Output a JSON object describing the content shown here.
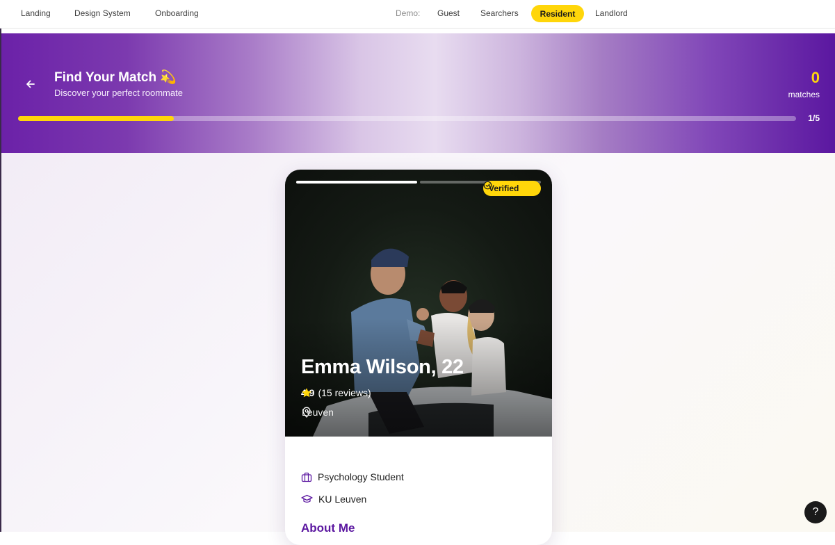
{
  "nav": {
    "landing": "Landing",
    "design_system": "Design System",
    "onboarding": "Onboarding",
    "demo_label": "Demo:",
    "guest": "Guest",
    "searchers": "Searchers",
    "resident": "Resident",
    "landlord": "Landlord"
  },
  "hero": {
    "title": "Find Your Match 💫",
    "subtitle": "Discover your perfect roommate",
    "match_count": "0",
    "match_label": "matches",
    "progress_text": "1/5",
    "progress_fraction": 0.2
  },
  "card": {
    "verified_label": "Verified",
    "name": "Emma Wilson, 22",
    "rating": "4.9",
    "reviews": "(15 reviews)",
    "location": "Leuven",
    "occupation": "Psychology Student",
    "university": "KU Leuven",
    "about_heading": "About Me",
    "photo_index": 1,
    "photo_count": 2
  },
  "help": {
    "label": "?"
  },
  "colors": {
    "accent_yellow": "#ffd60a",
    "brand_purple": "#5b17a0"
  },
  "icons": {
    "back": "arrow-left-icon",
    "verified": "check-circle-icon",
    "star": "star-icon",
    "location": "map-pin-icon",
    "occupation": "briefcase-icon",
    "university": "graduation-cap-icon"
  }
}
